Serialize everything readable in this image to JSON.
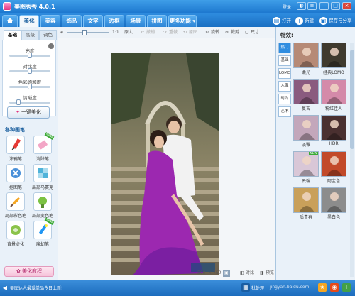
{
  "app": {
    "title": "美图秀秀 4.0.1",
    "login": "登录"
  },
  "menu": {
    "tabs": [
      "美化",
      "美容",
      "饰品",
      "文字",
      "边框",
      "场景",
      "拼图",
      "更多功能"
    ],
    "actions": {
      "open": "打开",
      "new": "新建",
      "save_share": "保存与分享"
    }
  },
  "left": {
    "subtabs": [
      "基础",
      "高级",
      "调色"
    ],
    "sliders": [
      {
        "label": "亮度",
        "value": 0.5
      },
      {
        "label": "对比度",
        "value": 0.5
      },
      {
        "label": "色彩饱和度",
        "value": 0.5
      },
      {
        "label": "清晰度",
        "value": 0.2
      }
    ],
    "beautify_label": "一键美化",
    "section_title": "各种画笔",
    "tools": [
      {
        "label": "涂鸦笔",
        "icon": "pen-icon",
        "new": false
      },
      {
        "label": "消除笔",
        "icon": "eraser-icon",
        "new": true
      },
      {
        "label": "抠图笔",
        "icon": "cutout-icon",
        "new": false
      },
      {
        "label": "局部马赛克",
        "icon": "mosaic-icon",
        "new": false
      },
      {
        "label": "局部彩色笔",
        "icon": "color-brush-icon",
        "new": false
      },
      {
        "label": "局部变色笔",
        "icon": "recolor-brush-icon",
        "new": false
      },
      {
        "label": "背景虚化",
        "icon": "blur-background-icon",
        "new": false
      },
      {
        "label": "魔幻笔",
        "icon": "magic-pen-icon",
        "new": true
      }
    ],
    "tutorial_label": "美化教程"
  },
  "toolbar": {
    "original_size": "原大",
    "undo": "撤销",
    "redo": "重做",
    "restore": "原图",
    "rotate": "旋转",
    "crop": "裁剪",
    "resize": "尺寸"
  },
  "canvas": {
    "size_w": "500",
    "size_x": "×",
    "size_h": "750",
    "compare": "对比",
    "tips": "预览"
  },
  "right": {
    "title": "特效:",
    "categories": [
      "热门",
      "基础",
      "LOMO",
      "人像",
      "时尚",
      "艺术"
    ],
    "effects": [
      {
        "label": "柔光",
        "new": false,
        "color": "#b68a76"
      },
      {
        "label": "经典LOMO",
        "new": false,
        "color": "#3f3a2e"
      },
      {
        "label": "复古",
        "new": false,
        "color": "#8a5b7f"
      },
      {
        "label": "粉红佳人",
        "new": false,
        "color": "#d48aa9"
      },
      {
        "label": "淡雅",
        "new": false,
        "color": "#c3a7bb"
      },
      {
        "label": "HDR",
        "new": false,
        "color": "#4a3030"
      },
      {
        "label": "云端",
        "new": true,
        "color": "#d9c7d7"
      },
      {
        "label": "阿宝色",
        "new": false,
        "color": "#c24a2a"
      },
      {
        "label": "后青春",
        "new": false,
        "color": "#c9a05a"
      },
      {
        "label": "黑白色",
        "new": false,
        "color": "#8c8c8c"
      }
    ]
  },
  "status": {
    "message": "美图达人最爱单品今日上新!",
    "batch": "批处理",
    "watermark": "jingyan.baidu.com"
  }
}
